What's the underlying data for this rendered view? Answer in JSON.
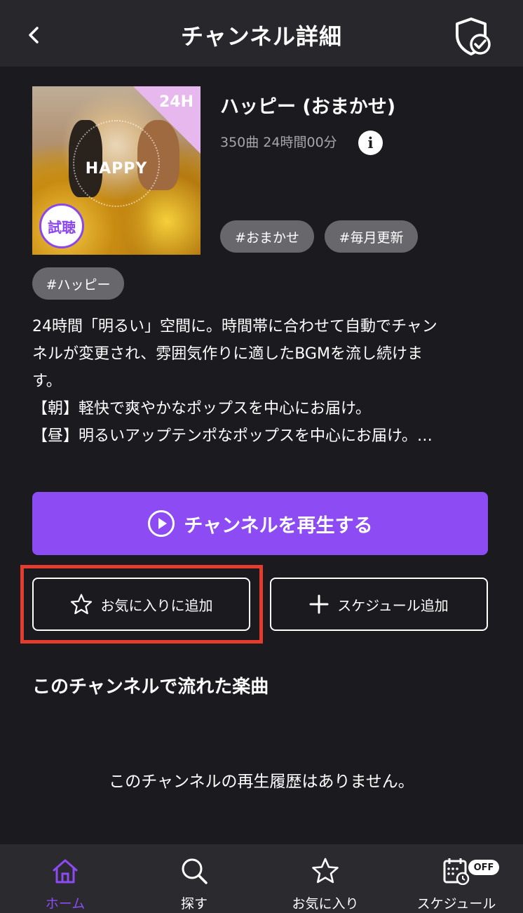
{
  "header": {
    "title": "チャンネル詳細",
    "back_icon": "chevron-left-icon",
    "shield_icon": "shield-check-icon"
  },
  "channel": {
    "name": "ハッピー (おまかせ)",
    "meta": "350曲 24時間00分",
    "artwork_badge": "24H",
    "artwork_title": "HAPPY",
    "trial_badge": "試聴",
    "info_label": "i",
    "tags": [
      "#おまかせ",
      "#毎月更新",
      "#ハッピー"
    ],
    "description_lines": [
      "24時間「明るい」空間に。時間帯に合わせて自動でチャン",
      "ネルが変更され、雰囲気作りに適したBGMを流し続けま",
      "す。",
      "【朝】軽快で爽やかなポップスを中心にお届け。",
      "【昼】明るいアップテンポなポップスを中心にお届け。…"
    ]
  },
  "actions": {
    "play_label": "チャンネルを再生する",
    "favorite_label": "お気に入りに追加",
    "schedule_label": "スケジュール追加"
  },
  "history": {
    "title": "このチャンネルで流れた楽曲",
    "empty_message": "このチャンネルの再生履歴はありません。"
  },
  "bottom_nav": {
    "items": [
      {
        "label": "ホーム",
        "icon": "home-icon",
        "active": true
      },
      {
        "label": "探す",
        "icon": "search-icon",
        "active": false
      },
      {
        "label": "お気に入り",
        "icon": "star-icon",
        "active": false
      },
      {
        "label": "スケジュール",
        "icon": "calendar-clock-icon",
        "active": false,
        "badge": "OFF"
      }
    ]
  },
  "colors": {
    "accent": "#8c4bf3",
    "background": "#1b1a1f",
    "highlight": "#e43d2f",
    "tag_bg": "#68676c"
  }
}
